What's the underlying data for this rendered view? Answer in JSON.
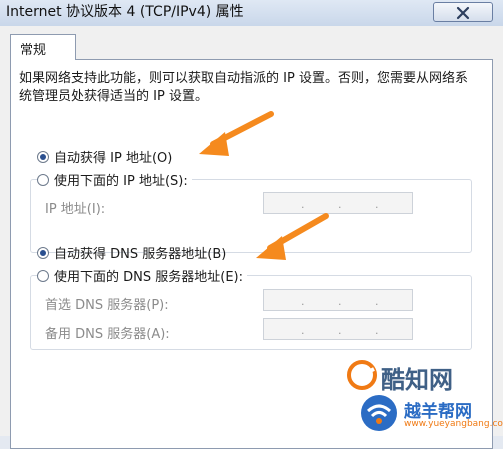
{
  "window": {
    "title": "Internet 协议版本 4 (TCP/IPv4) 属性",
    "close_label": "×"
  },
  "tabs": [
    {
      "label": "常规",
      "active": true
    }
  ],
  "description": "如果网络支持此功能，则可以获取自动指派的 IP 设置。否则，您需要从网络系统管理员处获得适当的 IP 设置。",
  "ip_section": {
    "auto_label": "自动获得 IP 地址(O)",
    "auto_selected": true,
    "manual_label": "使用下面的 IP 地址(S):",
    "manual_selected": false,
    "fields": [
      {
        "label": "IP 地址(I):",
        "value": ""
      }
    ]
  },
  "dns_section": {
    "auto_label": "自动获得 DNS 服务器地址(B)",
    "auto_selected": true,
    "manual_label": "使用下面的 DNS 服务器地址(E):",
    "manual_selected": false,
    "fields": [
      {
        "label": "首选 DNS 服务器(P):",
        "value": ""
      },
      {
        "label": "备用 DNS 服务器(A):",
        "value": ""
      }
    ]
  },
  "watermarks": {
    "kuzhi": "酷知网",
    "yueyang_cn": "越羊帮网",
    "yueyang_url": "www.yueyangbang.com"
  },
  "colors": {
    "arrow": "#f58a1e",
    "radio_dot": "#2a4f8f",
    "watermark_blue": "#2b6cc4",
    "watermark_orange": "#f07a14"
  },
  "ip_separator": "."
}
